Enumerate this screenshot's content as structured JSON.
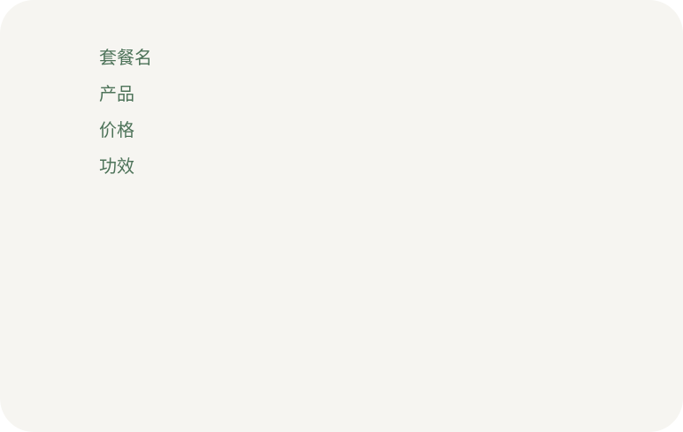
{
  "colors": {
    "background": "#f6f5f1",
    "label_text": "#4d7359"
  },
  "fields": [
    {
      "label": "套餐名"
    },
    {
      "label": "产品"
    },
    {
      "label": "价格"
    },
    {
      "label": "功效"
    }
  ]
}
